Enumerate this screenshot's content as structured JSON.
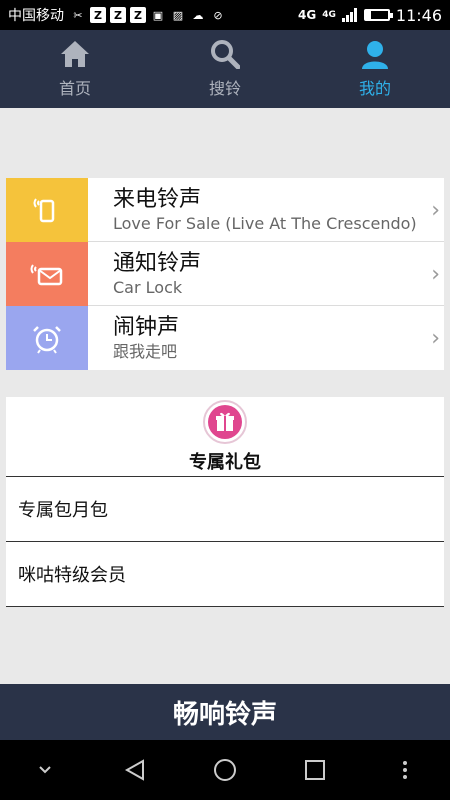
{
  "status_bar": {
    "carrier": "中国移动",
    "network": "4G",
    "network_small": "4G",
    "time": "11:46",
    "battery_level": 0.25
  },
  "nav": {
    "tabs": [
      {
        "label": "首页",
        "icon": "home-icon"
      },
      {
        "label": "搜铃",
        "icon": "search-icon"
      },
      {
        "label": "我的",
        "icon": "user-icon",
        "active": true
      }
    ],
    "active_color": "#2fb1ea"
  },
  "ringtones": [
    {
      "title": "来电铃声",
      "subtitle": "Love For Sale (Live At The Crescendo)",
      "icon": "phone-icon",
      "color": "#f5c33b"
    },
    {
      "title": "通知铃声",
      "subtitle": "Car Lock",
      "icon": "message-icon",
      "color": "#f47d5f"
    },
    {
      "title": "闹钟声",
      "subtitle": "跟我走吧",
      "icon": "alarm-clock-icon",
      "color": "#9aa6ef"
    }
  ],
  "gift": {
    "title": "专属礼包",
    "icon": "gift-icon",
    "icon_color": "#e0468f",
    "items": [
      "专属包月包",
      "咪咕特级会员"
    ]
  },
  "banner": {
    "title": "畅响铃声"
  }
}
